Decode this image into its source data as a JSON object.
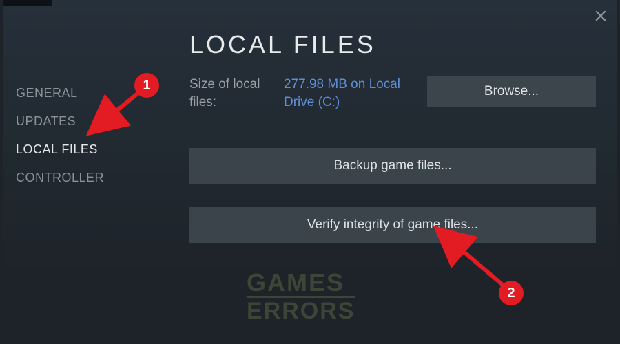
{
  "page_title": "LOCAL FILES",
  "sidebar": {
    "items": [
      {
        "label": "GENERAL",
        "active": false
      },
      {
        "label": "UPDATES",
        "active": false
      },
      {
        "label": "LOCAL FILES",
        "active": true
      },
      {
        "label": "CONTROLLER",
        "active": false
      }
    ]
  },
  "size": {
    "label": "Size of local files:",
    "value": "277.98 MB on Local Drive (C:)"
  },
  "buttons": {
    "browse": "Browse...",
    "backup": "Backup game files...",
    "verify": "Verify integrity of game files..."
  },
  "annotations": {
    "badge1": "1",
    "badge2": "2"
  },
  "watermark": {
    "line1": "GAMES",
    "line2": "ERRORS"
  }
}
